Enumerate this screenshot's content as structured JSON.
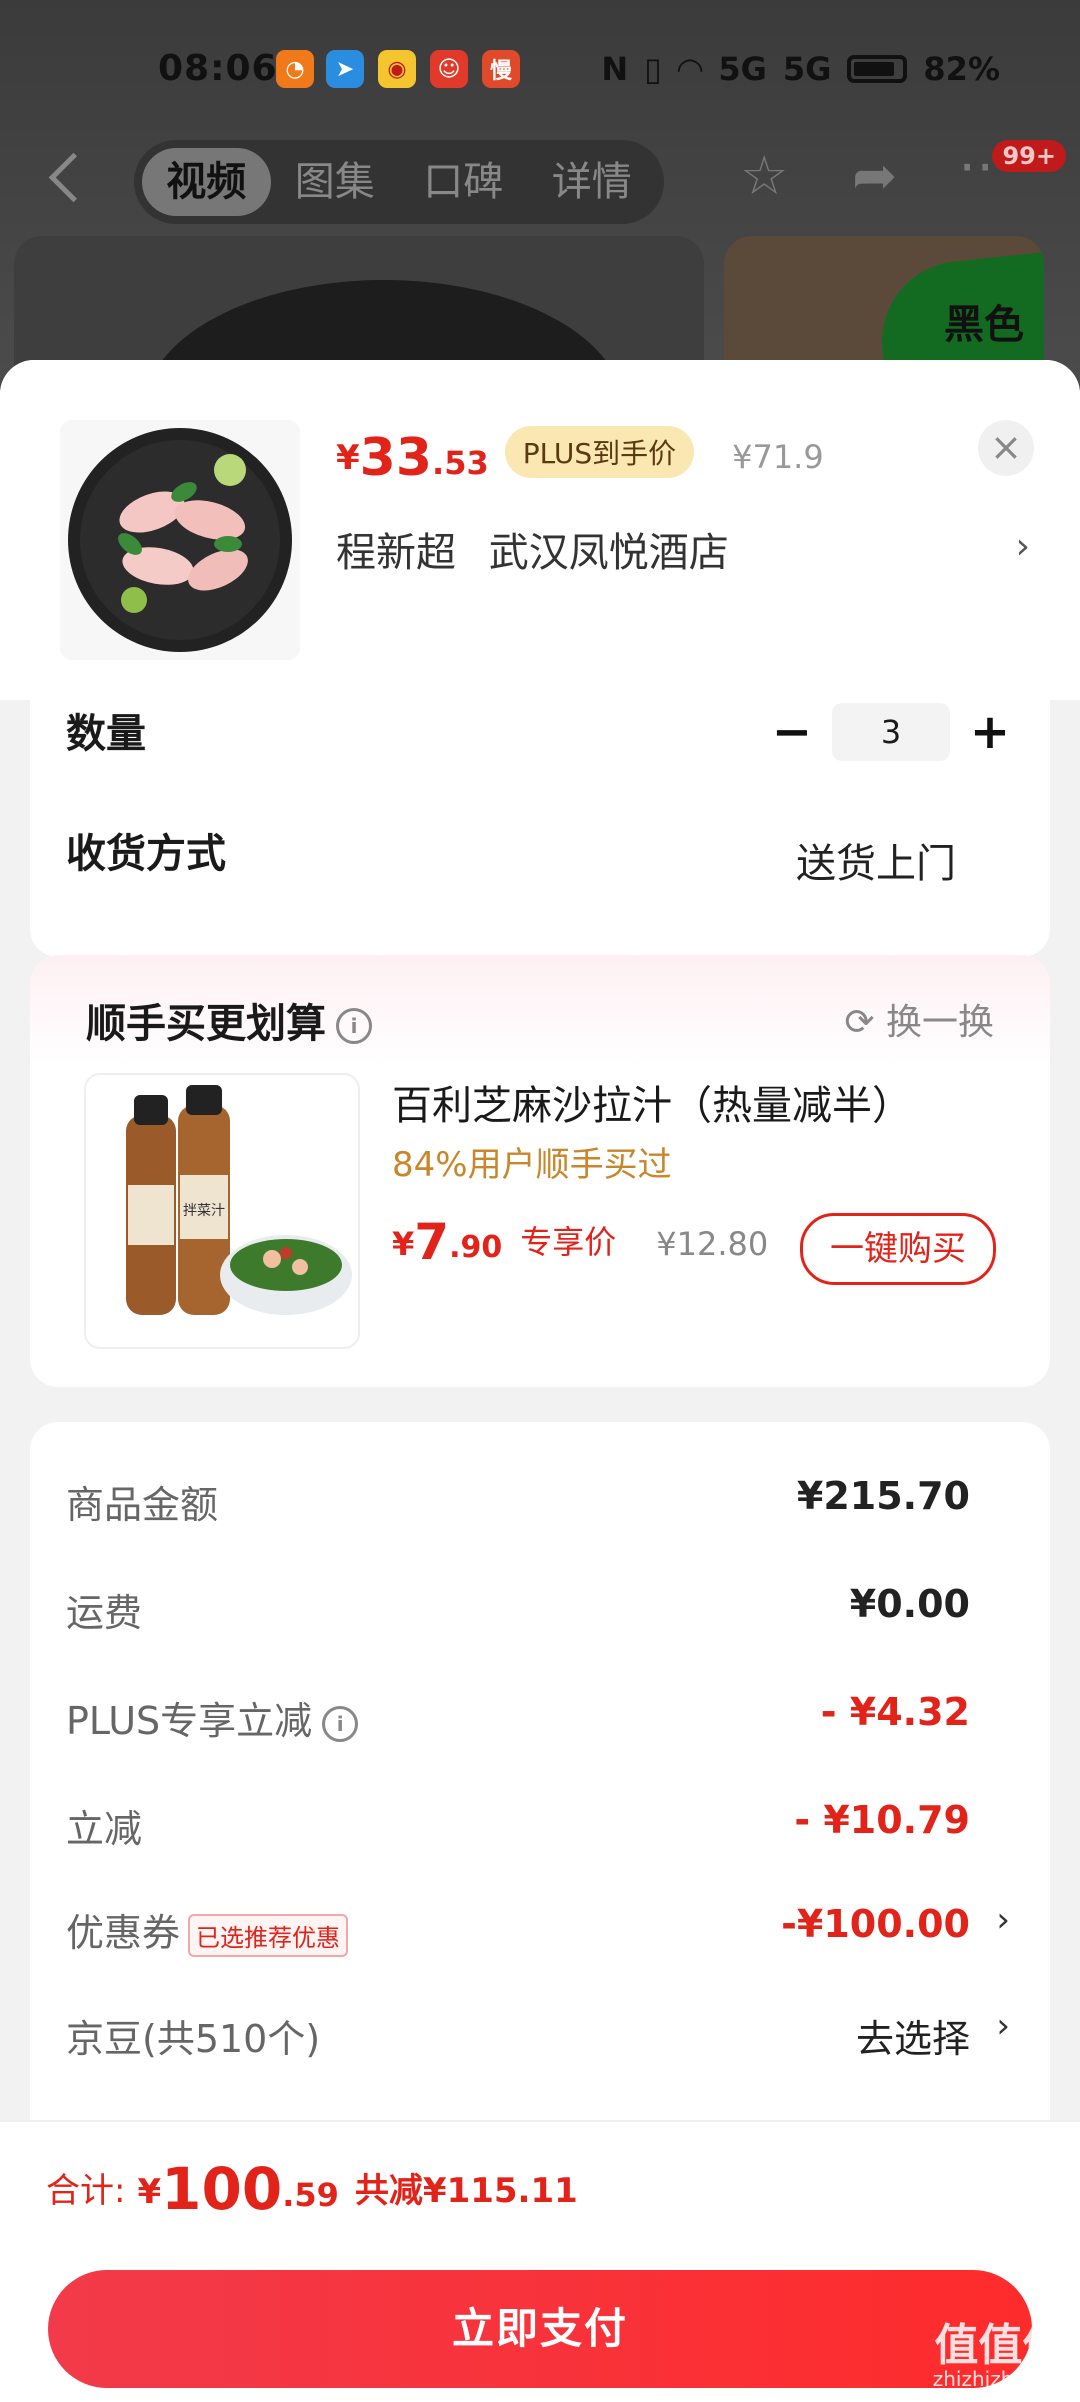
{
  "status_bar": {
    "time": "08:06",
    "battery": "82%",
    "signal_text": "5G"
  },
  "bg_nav": {
    "tabs": [
      {
        "label": "视频",
        "active": true
      },
      {
        "label": "图集",
        "active": false
      },
      {
        "label": "口碑",
        "active": false
      },
      {
        "label": "详情",
        "active": false
      }
    ],
    "badge": "99+",
    "promo_text": "黑色"
  },
  "product": {
    "price_currency": "¥",
    "price_int": "33",
    "price_dec": ".53",
    "plus_tag": "PLUS到手价",
    "orig_price": "¥71.9",
    "seller_name": "程新超",
    "seller_address": "武汉凤悦酒店"
  },
  "quantity": {
    "label": "数量",
    "value": "3",
    "minus": "−",
    "plus": "+"
  },
  "delivery": {
    "label": "收货方式",
    "value": "送货上门"
  },
  "addon": {
    "title": "顺手买更划算",
    "refresh_label": "换一换",
    "name": "百利芝麻沙拉汁（热量减半）",
    "bought_pct": "84%用户顺手买过",
    "price_currency": "¥",
    "price_int": "7",
    "price_dec": ".90",
    "exclusive_label": "专享价",
    "orig_price": "¥12.80",
    "buy_button": "一键购买",
    "bottle_label": "拌菜汁"
  },
  "summary": {
    "rows": [
      {
        "label": "商品金额",
        "value": "¥215.70"
      },
      {
        "label": "运费",
        "value": "¥0.00"
      },
      {
        "label": "PLUS专享立减",
        "value": "- ¥4.32"
      },
      {
        "label": "立减",
        "value": "- ¥10.79"
      },
      {
        "label": "优惠券",
        "tag": "已选推荐优惠",
        "value": "-¥100.00"
      },
      {
        "label": "京豆(共510个)",
        "value": "去选择"
      }
    ]
  },
  "footer": {
    "total_label": "合计:",
    "total_currency": "¥",
    "total_int": "100",
    "total_dec": ".59",
    "total_saved": "共减¥115.11",
    "pay_button": "立即支付"
  },
  "watermark": {
    "main": "值值值",
    "sub": "zhizhizhi.com"
  },
  "colors": {
    "accent_red": "#e2231a",
    "plus_gold": "#fbe7b2",
    "pct_orange": "#c9862a"
  }
}
